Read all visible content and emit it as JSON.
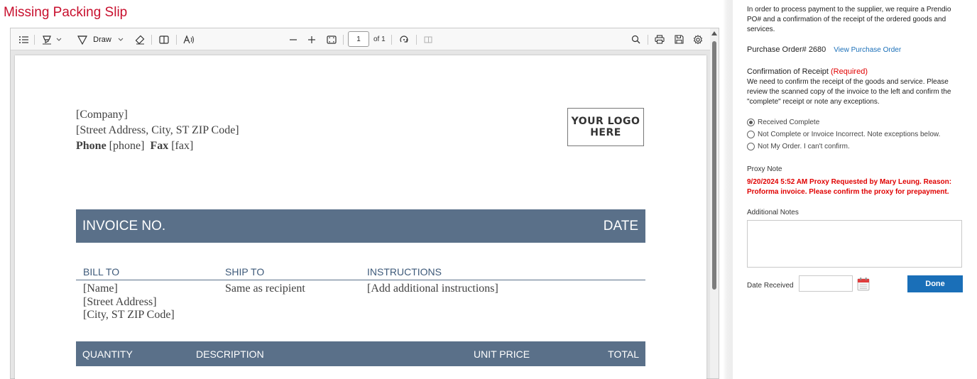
{
  "page": {
    "title": "Missing Packing Slip"
  },
  "viewer": {
    "toolbar": {
      "draw_label": "Draw",
      "page_number": "1",
      "page_of": "of 1"
    },
    "document": {
      "company": "[Company]",
      "street": "[Street Address, City, ST ZIP Code]",
      "phone_label": "Phone",
      "phone_value": "[phone]",
      "fax_label": "Fax",
      "fax_value": "[fax]",
      "logo_line1": "YOUR LOGO",
      "logo_line2": "HERE",
      "invoice_no": "INVOICE NO.",
      "date": "DATE",
      "bill_to": "BILL TO",
      "ship_to": "SHIP TO",
      "instructions": "INSTRUCTIONS",
      "bill_name": "[Name]",
      "bill_street": "[Street Address]",
      "bill_city": "[City, ST ZIP Code]",
      "ship_to_value": "Same as recipient",
      "instructions_value": "[Add additional instructions]",
      "col_quantity": "QUANTITY",
      "col_description": "DESCRIPTION",
      "col_unit_price": "UNIT PRICE",
      "col_total": "TOTAL"
    }
  },
  "panel": {
    "intro": "In order to process payment to the supplier, we require a Prendio PO# and a confirmation of the receipt of the ordered goods and services.",
    "po_label": "Purchase Order# 2680",
    "po_link": "View Purchase Order",
    "confirmation_title": "Confirmation of Receipt",
    "confirmation_required": "(Required)",
    "confirmation_text": "We need to confirm the receipt of the goods and service. Please review the scanned copy of the invoice to the left and confirm the \"complete\" receipt or note any exceptions.",
    "options": [
      {
        "label": "Received Complete",
        "selected": true
      },
      {
        "label": "Not Complete or Invoice Incorrect. Note exceptions below.",
        "selected": false
      },
      {
        "label": "Not My Order. I can't confirm.",
        "selected": false
      }
    ],
    "proxy_title": "Proxy Note",
    "proxy_line1": "9/20/2024 5:52 AM Proxy Requested by Mary Leung. Reason:",
    "proxy_line2": "Proforma invoice. Please confirm the proxy for prepayment.",
    "notes_title": "Additional Notes",
    "notes_value": "",
    "date_label": "Date Received",
    "date_value": "",
    "done_label": "Done"
  },
  "colors": {
    "title_red": "#c8102e",
    "header_bar": "#5a7089",
    "required_red": "#e00000",
    "link_blue": "#1a6fb8",
    "button_blue": "#1a6fb8"
  },
  "icons": [
    "outline-icon",
    "highlight-icon",
    "chevron-down-icon",
    "draw-icon",
    "eraser-icon",
    "text-icon",
    "read-aloud-icon",
    "zoom-out-icon",
    "zoom-in-icon",
    "fit-page-icon",
    "rotate-icon",
    "page-view-icon",
    "search-icon",
    "print-icon",
    "save-icon",
    "settings-icon",
    "calendar-icon"
  ]
}
